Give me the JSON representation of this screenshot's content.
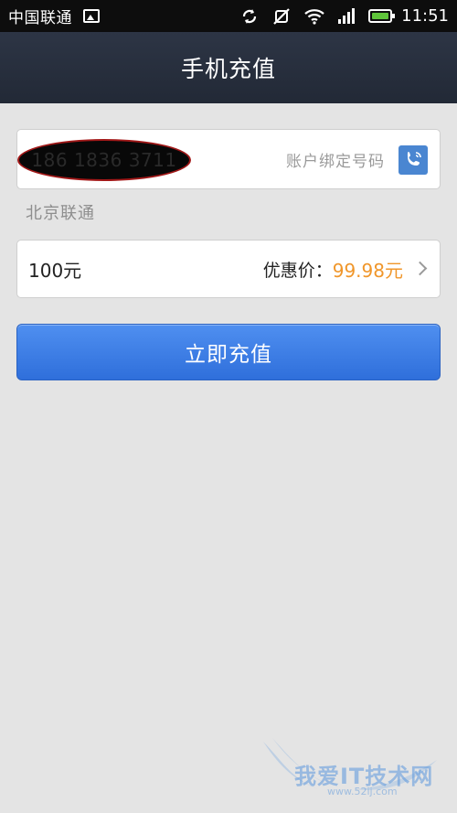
{
  "status_bar": {
    "carrier": "中国联通",
    "time": "11:51"
  },
  "header": {
    "title": "手机充值"
  },
  "phone_field": {
    "number": "186 1836 3711",
    "bound_label": "账户绑定号码"
  },
  "carrier_hint": "北京联通",
  "amount_row": {
    "amount": "100元",
    "price_label": "优惠价：",
    "price_value": "99.98元"
  },
  "recharge_button": {
    "label": "立即充值"
  },
  "watermark": {
    "text": "我爱IT技术网",
    "url": "www.52ij.com"
  },
  "colors": {
    "accent_blue": "#3a7be6",
    "price_orange": "#f0962a",
    "battery_green": "#5fc43a"
  },
  "icons": [
    "gallery-icon",
    "sync-icon",
    "mute-icon",
    "wifi-icon",
    "signal-icon",
    "battery-icon",
    "contact-phone-icon",
    "chevron-right-icon"
  ]
}
